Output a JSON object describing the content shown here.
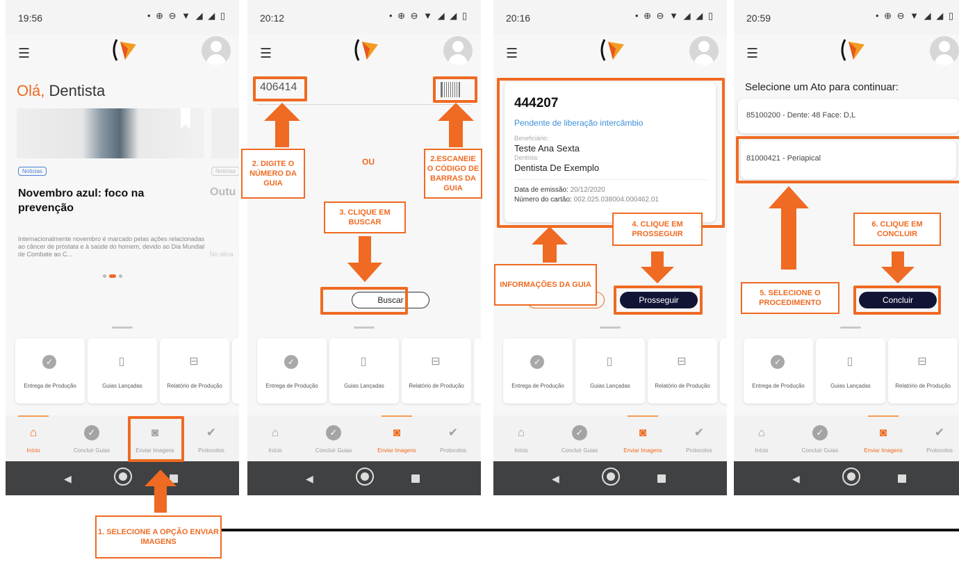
{
  "colors": {
    "accent": "#ef6a22",
    "dark_button": "#111435",
    "nav_bar": "#3f4143"
  },
  "common": {
    "menu_icon": "hamburger-icon",
    "tiles": [
      "Entrega de Produção",
      "Guias Lançadas",
      "Relatório de Produção"
    ],
    "nav": [
      "Início",
      "Concluir Guias",
      "Enviar Imagens",
      "Protocolos"
    ]
  },
  "p1": {
    "time": "19:56",
    "greet_prefix": "Olá,",
    "greet_name": "Dentista",
    "tag": "Notícias",
    "tag2": "Notícias",
    "headline": "Novembro azul: foco na prevenção",
    "headline2": "Outu",
    "body": "Internacionalmente novembro é marcado pelas ações relacionadas ao câncer de próstata e à saúde do homem, devido ao Dia Mundial de Combate ao C...",
    "body2": "No déca"
  },
  "p2": {
    "time": "20:12",
    "input_value": "406414",
    "or_text": "OU",
    "search_button": "Buscar"
  },
  "p3": {
    "time": "20:16",
    "guide_number": "444207",
    "status": "Pendente de liberação intercâmbio",
    "ben_label": "Beneficiário:",
    "ben_value": "Teste Ana Sexta",
    "den_label": "Dentista:",
    "den_value": "Dentista De Exemplo",
    "date_label": "Data de emissão:",
    "date_value": "20/12/2020",
    "card_label": "Número do cartão:",
    "card_value": "002.025.038004.000462.01",
    "proceed_button": "Prosseguir"
  },
  "p4": {
    "time": "20:59",
    "title": "Selecione um Ato para continuar:",
    "items": [
      "85100200 - Dente: 48 Face: D,L",
      "81000421 - Periapical"
    ],
    "conclude_button": "Concluir"
  },
  "callouts": {
    "c1": "1. SELECIONE A OPÇÃO ENVIAR IMAGENS",
    "c2a": "2. DIGITE O NÚMERO DA GUIA",
    "c2b": "2.ESCANEIE O CÓDIGO DE BARRAS DA GUIA",
    "c3": "3. CLIQUE EM BUSCAR",
    "c4": "4. CLIQUE EM PROSSEGUIR",
    "info": "INFORMAÇÕES DA GUIA",
    "c5": "5. SELECIONE O PROCEDIMENTO",
    "c6": "6. CLIQUE EM CONCLUIR"
  }
}
